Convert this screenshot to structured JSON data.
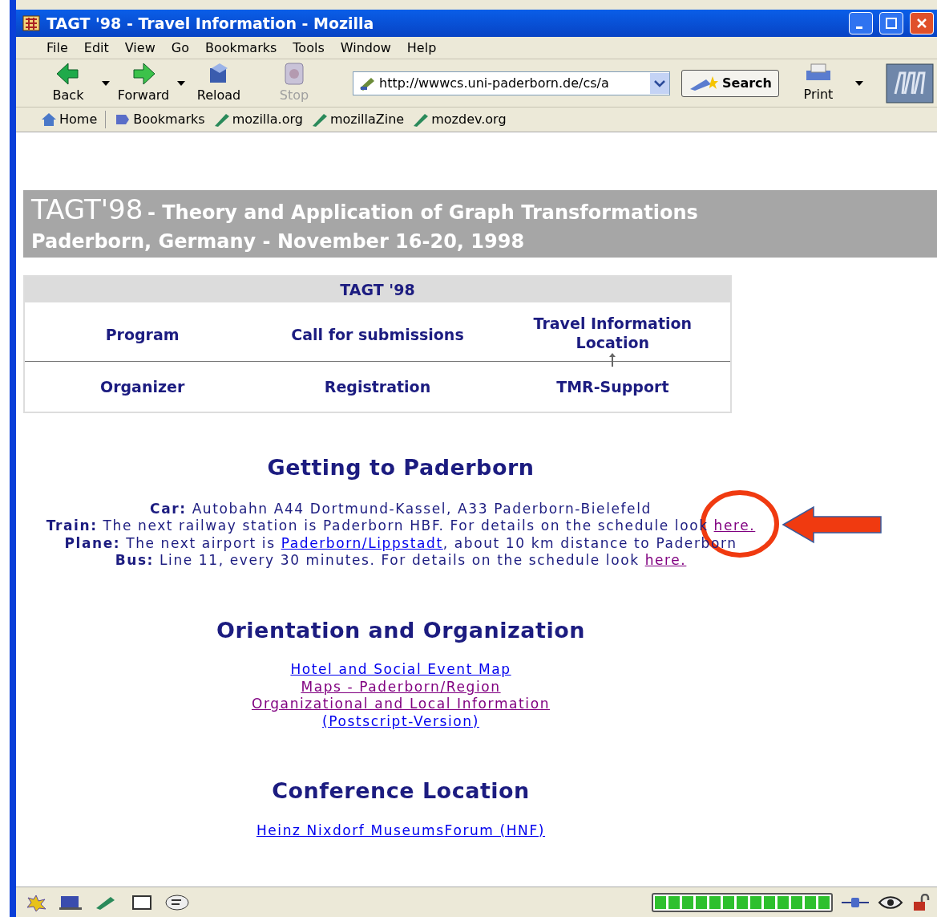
{
  "window": {
    "title": "TAGT '98 - Travel Information - Mozilla"
  },
  "menu": [
    "File",
    "Edit",
    "View",
    "Go",
    "Bookmarks",
    "Tools",
    "Window",
    "Help"
  ],
  "toolbar": {
    "buttons": [
      {
        "label": "Back",
        "disabled": false,
        "dropdown": true
      },
      {
        "label": "Forward",
        "disabled": false,
        "dropdown": true
      },
      {
        "label": "Reload",
        "disabled": false,
        "dropdown": false
      },
      {
        "label": "Stop",
        "disabled": true,
        "dropdown": false
      }
    ],
    "url": "http://wwwcs.uni-paderborn.de/cs/a",
    "search": "Search",
    "print": "Print"
  },
  "bookmarks": [
    "Home",
    "Bookmarks",
    "mozilla.org",
    "mozillaZine",
    "mozdev.org"
  ],
  "banner": {
    "title": "TAGT'98",
    "subtitle": "- Theory and Application of Graph Transformations",
    "line2": "Paderborn, Germany - November 16-20, 1998"
  },
  "nav": {
    "title": "TAGT '98",
    "rows": [
      [
        {
          "label": "Program",
          "selected": false
        },
        {
          "label": "Call for submissions",
          "selected": false
        },
        {
          "label": "Travel Information Location",
          "selected": true
        }
      ],
      [
        {
          "label": "Organizer",
          "selected": false
        },
        {
          "label": "Registration",
          "selected": false
        },
        {
          "label": "TMR-Support",
          "selected": false
        }
      ]
    ]
  },
  "sections": [
    {
      "heading": "Getting to Paderborn",
      "kind": "lines",
      "lines": [
        {
          "text": "**Car:** Autobahn A44 Dortmund-Kassel, A33 Paderborn-Bielefeld"
        },
        {
          "text": "**Train:** The next railway station is Paderborn HBF. For details on the schedule look ",
          "link": {
            "text": "here.",
            "visited": true
          }
        },
        {
          "text": "**Plane:** The next airport is ",
          "link": {
            "text": "Paderborn/Lippstadt",
            "visited": false
          },
          "after": ", about 10 km distance to Paderborn"
        },
        {
          "text": "**Bus:** Line 11, every 30 minutes. For details on the schedule look ",
          "link": {
            "text": "here.",
            "visited": true
          }
        }
      ]
    },
    {
      "heading": "Orientation and Organization",
      "kind": "links",
      "links": [
        {
          "text": "Hotel and Social Event Map",
          "visited": false
        },
        {
          "text": "Maps - Paderborn/Region",
          "visited": true
        },
        {
          "text": "Organizational and Local Information",
          "visited": true
        },
        {
          "text": "(Postscript-Version)",
          "visited": false
        }
      ]
    },
    {
      "heading": "Conference Location",
      "kind": "links",
      "links": [
        {
          "text": "Heinz Nixdorf MuseumsForum (HNF)",
          "visited": false
        }
      ]
    }
  ],
  "status_bar": {
    "progress": {
      "level": 1
    }
  }
}
